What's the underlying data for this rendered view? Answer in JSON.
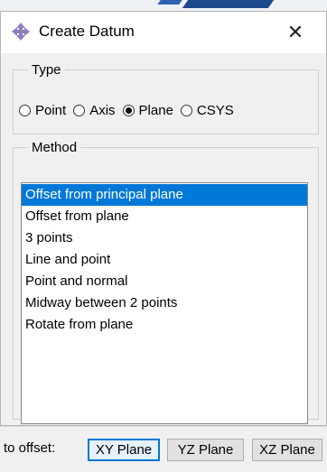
{
  "window": {
    "title": "Create Datum",
    "close_glyph": "✕",
    "icon": "datum-arrows-icon"
  },
  "type_group": {
    "legend": "Type",
    "options": [
      {
        "label": "Point",
        "checked": false
      },
      {
        "label": "Axis",
        "checked": false
      },
      {
        "label": "Plane",
        "checked": true
      },
      {
        "label": "CSYS",
        "checked": false
      }
    ]
  },
  "method_group": {
    "legend": "Method",
    "items": [
      "Offset from principal plane",
      "Offset from plane",
      "3 points",
      "Line and point",
      "Point and normal",
      "Midway between 2 points",
      "Rotate from plane"
    ],
    "selected_index": 0
  },
  "prompt_bar": {
    "prompt": "to offset:",
    "buttons": [
      "XY Plane",
      "YZ Plane",
      "XZ Plane"
    ],
    "active_index": 0
  },
  "colors": {
    "selection": "#0078d7",
    "icon_purple": "#8e7cc3"
  }
}
